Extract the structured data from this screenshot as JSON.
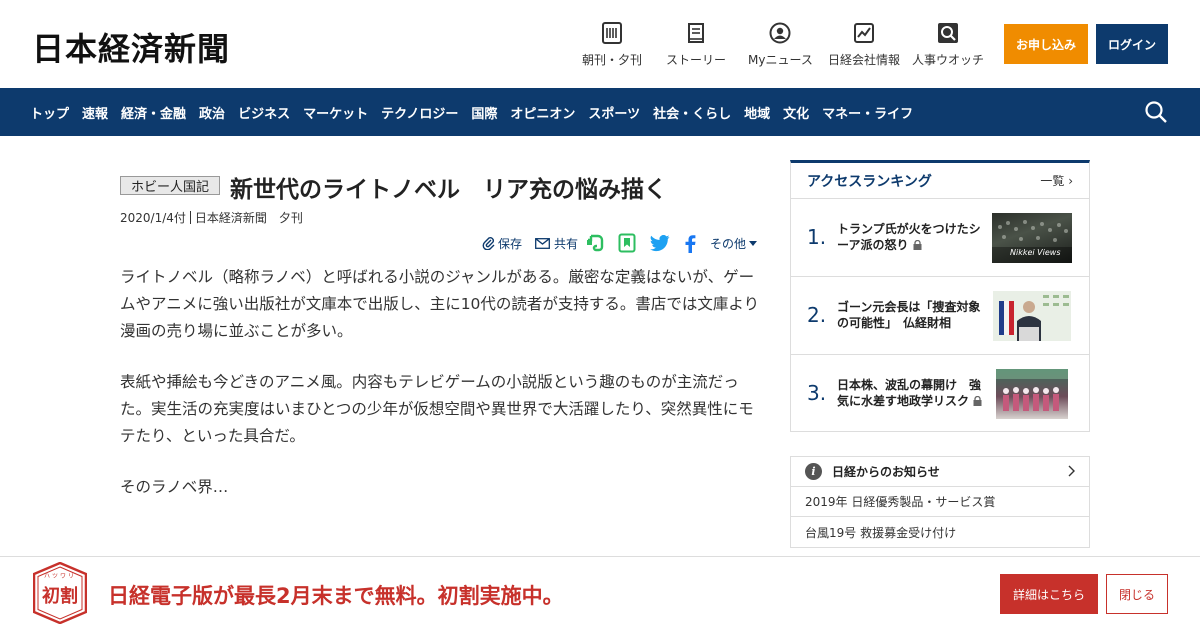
{
  "header": {
    "logo": "日本経済新聞",
    "nav": [
      {
        "label": "朝刊・夕刊",
        "icon": "newspaper-icon"
      },
      {
        "label": "ストーリー",
        "icon": "book-icon"
      },
      {
        "label": "Myニュース",
        "icon": "person-icon"
      },
      {
        "label": "日経会社情報",
        "icon": "chart-icon"
      },
      {
        "label": "人事ウオッチ",
        "icon": "search-person-icon"
      }
    ],
    "subscribe_label": "お申し込み",
    "login_label": "ログイン"
  },
  "mainnav": {
    "items": [
      "トップ",
      "速報",
      "経済・金融",
      "政治",
      "ビジネス",
      "マーケット",
      "テクノロジー",
      "国際",
      "オピニオン",
      "スポーツ",
      "社会・くらし",
      "地域",
      "文化",
      "マネー・ライフ"
    ]
  },
  "article": {
    "tag": "ホビー人国記",
    "headline": "新世代のライトノベル　リア充の悩み描く",
    "date": "2020/1/4付",
    "source": "日本経済新聞　夕刊",
    "tools": {
      "save": "保存",
      "share": "共有",
      "other": "その他"
    },
    "paragraphs": [
      "ライトノベル（略称ラノベ）と呼ばれる小説のジャンルがある。厳密な定義はないが、ゲームやアニメに強い出版社が文庫本で出版し、主に10代の読者が支持する。書店では文庫より漫画の売り場に並ぶことが多い。",
      "表紙や挿絵も今どきのアニメ風。内容もテレビゲームの小説版という趣のものが主流だった。実生活の充実度はいまひとつの少年が仮想空間や異世界で大活躍したり、突然異性にモテたり、といった具合だ。",
      "そのラノベ界…"
    ]
  },
  "ranking": {
    "title": "アクセスランキング",
    "more": "一覧",
    "items": [
      {
        "num": "1.",
        "title": "トランプ氏が火をつけたシーア派の怒り",
        "thumb_caption": "Nikkei Views"
      },
      {
        "num": "2.",
        "title": "ゴーン元会長は「捜査対象の可能性」　仏経財相"
      },
      {
        "num": "3.",
        "title": "日本株、波乱の幕開け　強気に水差す地政学リスク"
      }
    ]
  },
  "notice": {
    "title": "日経からのお知らせ",
    "items": [
      "2019年 日経優秀製品・サービス賞",
      "台風19号 救援募金受け付け"
    ]
  },
  "banner": {
    "badge_main": "初割",
    "badge_ruby": "ハツワリ",
    "text": "日経電子版が最長2月末まで無料。初割実施中。",
    "detail_label": "詳細はこちら",
    "close_label": "閉じる"
  }
}
